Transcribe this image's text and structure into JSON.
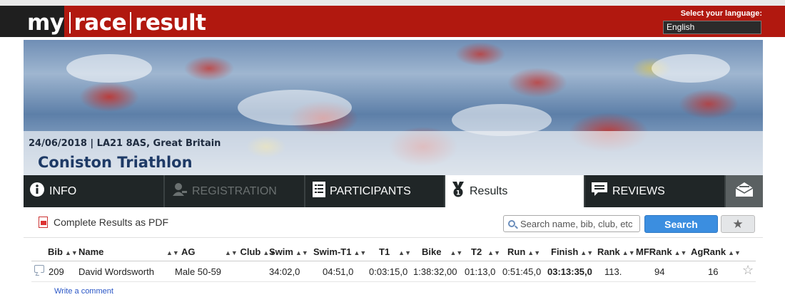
{
  "header": {
    "logo_parts": [
      "my",
      "race",
      "result"
    ],
    "language_label": "Select your language:",
    "language_value": "English"
  },
  "event": {
    "date_location": "24/06/2018 | LA21 8AS, Great Britain",
    "title": "Coniston Triathlon"
  },
  "nav": {
    "info": "INFO",
    "registration": "REGISTRATION",
    "participants": "PARTICIPANTS",
    "results": "Results",
    "reviews": "REVIEWS"
  },
  "toolbar": {
    "pdf_link": "Complete Results as PDF",
    "search_placeholder": "Search name, bib, club, etc",
    "search_button": "Search",
    "favorite_icon": "★"
  },
  "table": {
    "columns": [
      "Bib",
      "Name",
      "AG",
      "Club",
      "Swim",
      "Swim-T1",
      "T1",
      "Bike",
      "T2",
      "Run",
      "Finish",
      "Rank",
      "MFRank",
      "AgRank"
    ],
    "rows": [
      {
        "bib": "209",
        "name": "David Wordsworth",
        "ag": "Male 50-59",
        "club": "",
        "swim": "34:02,0",
        "swim_t1": "04:51,0",
        "t1": "0:03:15,0",
        "bike": "1:38:32,00",
        "t2": "01:13,0",
        "run": "0:51:45,0",
        "finish": "03:13:35,0",
        "rank": "113.",
        "mfrank": "94",
        "agrank": "16"
      }
    ],
    "write_comment": "Write a comment"
  },
  "colors": {
    "header_red": "#b1180f",
    "nav_dark": "#202627",
    "search_blue": "#3b8ee0",
    "title_blue": "#1e3a66"
  }
}
